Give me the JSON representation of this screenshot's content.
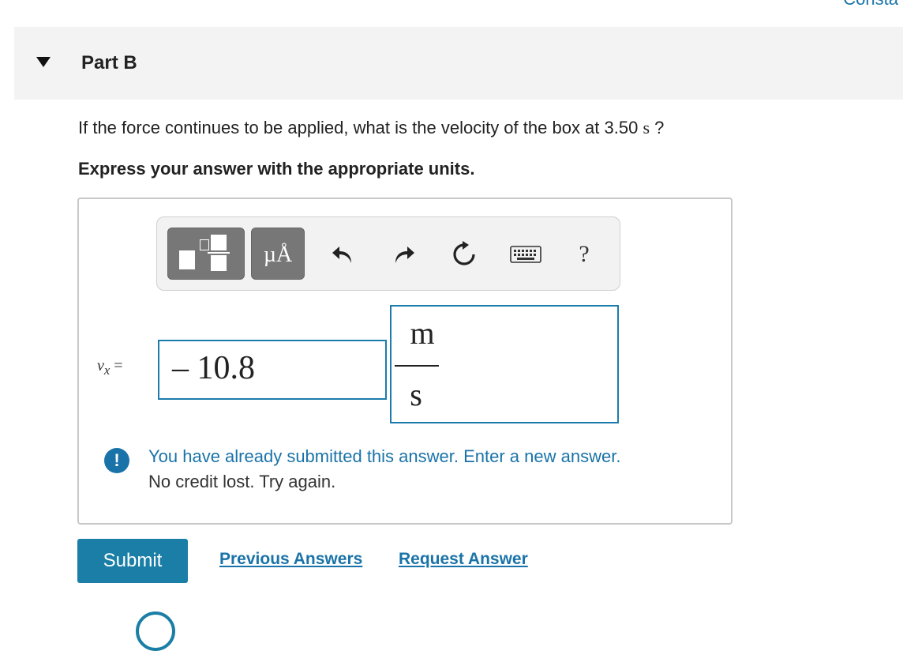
{
  "top_right_cut_text": "Consta",
  "part": {
    "title": "Part B",
    "toggle_icon": "caret-down-icon"
  },
  "question": {
    "text_before": "If the force continues to be applied, what is the velocity of the box at 3.50 ",
    "unit": "s",
    "text_after": " ?"
  },
  "instruction": "Express your answer with the appropriate units.",
  "toolbar": {
    "units_label": "µÅ",
    "help_label": "?",
    "icons": [
      "templates-icon",
      "units-icon",
      "undo-icon",
      "redo-icon",
      "reset-icon",
      "keyboard-icon",
      "help-icon"
    ]
  },
  "answer": {
    "variable_base": "v",
    "variable_sub": "x",
    "equals": "=",
    "value": "– 10.8",
    "unit_numerator": "m",
    "unit_denominator": "s"
  },
  "feedback": {
    "icon": "alert-icon",
    "icon_glyph": "!",
    "line1": "You have already submitted this answer. Enter a new answer.",
    "line2": "No credit lost. Try again."
  },
  "actions": {
    "submit_label": "Submit",
    "previous_answers_label": "Previous Answers",
    "request_answer_label": "Request Answer"
  },
  "colors": {
    "accent": "#1a73a8",
    "submit_bg": "#1a7ea6",
    "header_bg": "#f3f3f3"
  }
}
